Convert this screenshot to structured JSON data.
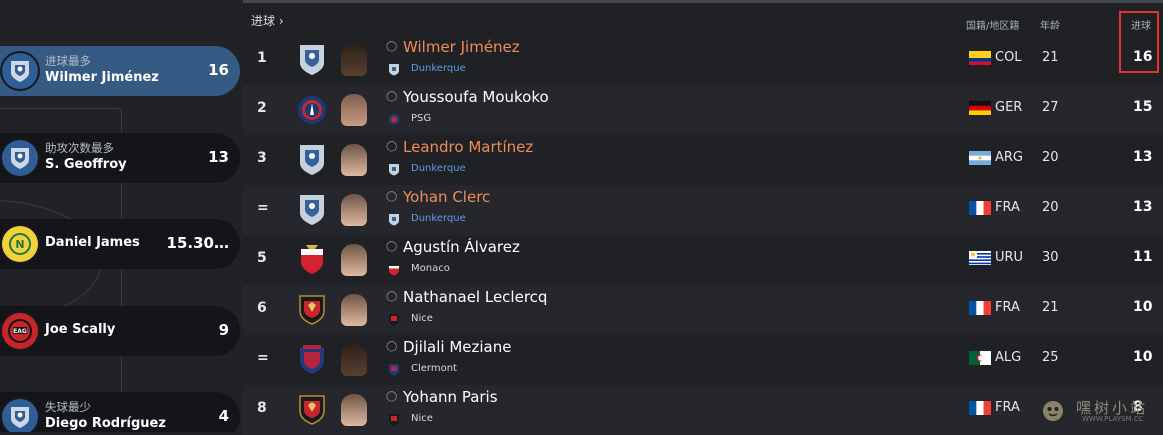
{
  "header": {
    "title": "进球 ›",
    "col_nationality": "国籍/地区籍",
    "col_age": "年龄",
    "col_goals": "进球"
  },
  "highlights": [
    {
      "label": "进球最多",
      "name": "Wilmer Jiménez",
      "value": "16",
      "badge": "Dunkerque"
    },
    {
      "label": "助攻次数最多",
      "name": "S. Geoffroy",
      "value": "13",
      "badge": "Dunkerque"
    },
    {
      "label": "",
      "name": "Daniel James",
      "value": "15.30…",
      "badge": "Nantes"
    },
    {
      "label": "",
      "name": "Joe Scally",
      "value": "9",
      "badge": "Guingamp"
    },
    {
      "label": "失球最少",
      "name": "Diego Rodríguez",
      "value": "4",
      "badge": "Dunkerque"
    }
  ],
  "rows": [
    {
      "rank": "1",
      "name": "Wilmer Jiménez",
      "club": "Dunkerque",
      "nation": "COL",
      "age": "21",
      "goals": "16",
      "loan": true
    },
    {
      "rank": "2",
      "name": "Youssoufa Moukoko",
      "club": "PSG",
      "nation": "GER",
      "age": "27",
      "goals": "15",
      "loan": false
    },
    {
      "rank": "3",
      "name": "Leandro Martínez",
      "club": "Dunkerque",
      "nation": "ARG",
      "age": "20",
      "goals": "13",
      "loan": true
    },
    {
      "rank": "=",
      "name": "Yohan Clerc",
      "club": "Dunkerque",
      "nation": "FRA",
      "age": "20",
      "goals": "13",
      "loan": true
    },
    {
      "rank": "5",
      "name": "Agustín Álvarez",
      "club": "Monaco",
      "nation": "URU",
      "age": "30",
      "goals": "11",
      "loan": false
    },
    {
      "rank": "6",
      "name": "Nathanael Leclercq",
      "club": "Nice",
      "nation": "FRA",
      "age": "21",
      "goals": "10",
      "loan": false
    },
    {
      "rank": "=",
      "name": "Djilali Meziane",
      "club": "Clermont",
      "nation": "ALG",
      "age": "25",
      "goals": "10",
      "loan": false
    },
    {
      "rank": "8",
      "name": "Yohann Paris",
      "club": "Nice",
      "nation": "FRA",
      "age": "",
      "goals": "8",
      "loan": false
    }
  ],
  "watermark": {
    "cn": "嘿树小站",
    "en": "WWW.PLAYSM.CC"
  },
  "colors": {
    "accent_card": "#355a83",
    "loan_name": "#ef8c58",
    "club_link": "#5c9de8",
    "highlight_box": "#e03434"
  }
}
